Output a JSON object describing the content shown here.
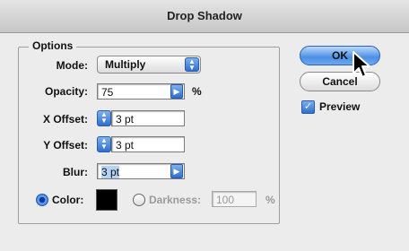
{
  "window": {
    "title": "Drop Shadow"
  },
  "options": {
    "legend": "Options",
    "mode": {
      "label": "Mode:",
      "value": "Multiply"
    },
    "opacity": {
      "label": "Opacity:",
      "value": "75",
      "unit": "%"
    },
    "x_offset": {
      "label": "X Offset:",
      "value": "3 pt"
    },
    "y_offset": {
      "label": "Y Offset:",
      "value": "3 pt"
    },
    "blur": {
      "label": "Blur:",
      "value": "3 pt"
    },
    "color": {
      "label": "Color:",
      "selected": true,
      "swatch": "#000000"
    },
    "darkness": {
      "label": "Darkness:",
      "value": "100",
      "unit": "%",
      "selected": false
    }
  },
  "buttons": {
    "ok": "OK",
    "cancel": "Cancel"
  },
  "preview": {
    "label": "Preview",
    "checked": true
  },
  "icons": {
    "cursor": "arrow-cursor-icon"
  }
}
